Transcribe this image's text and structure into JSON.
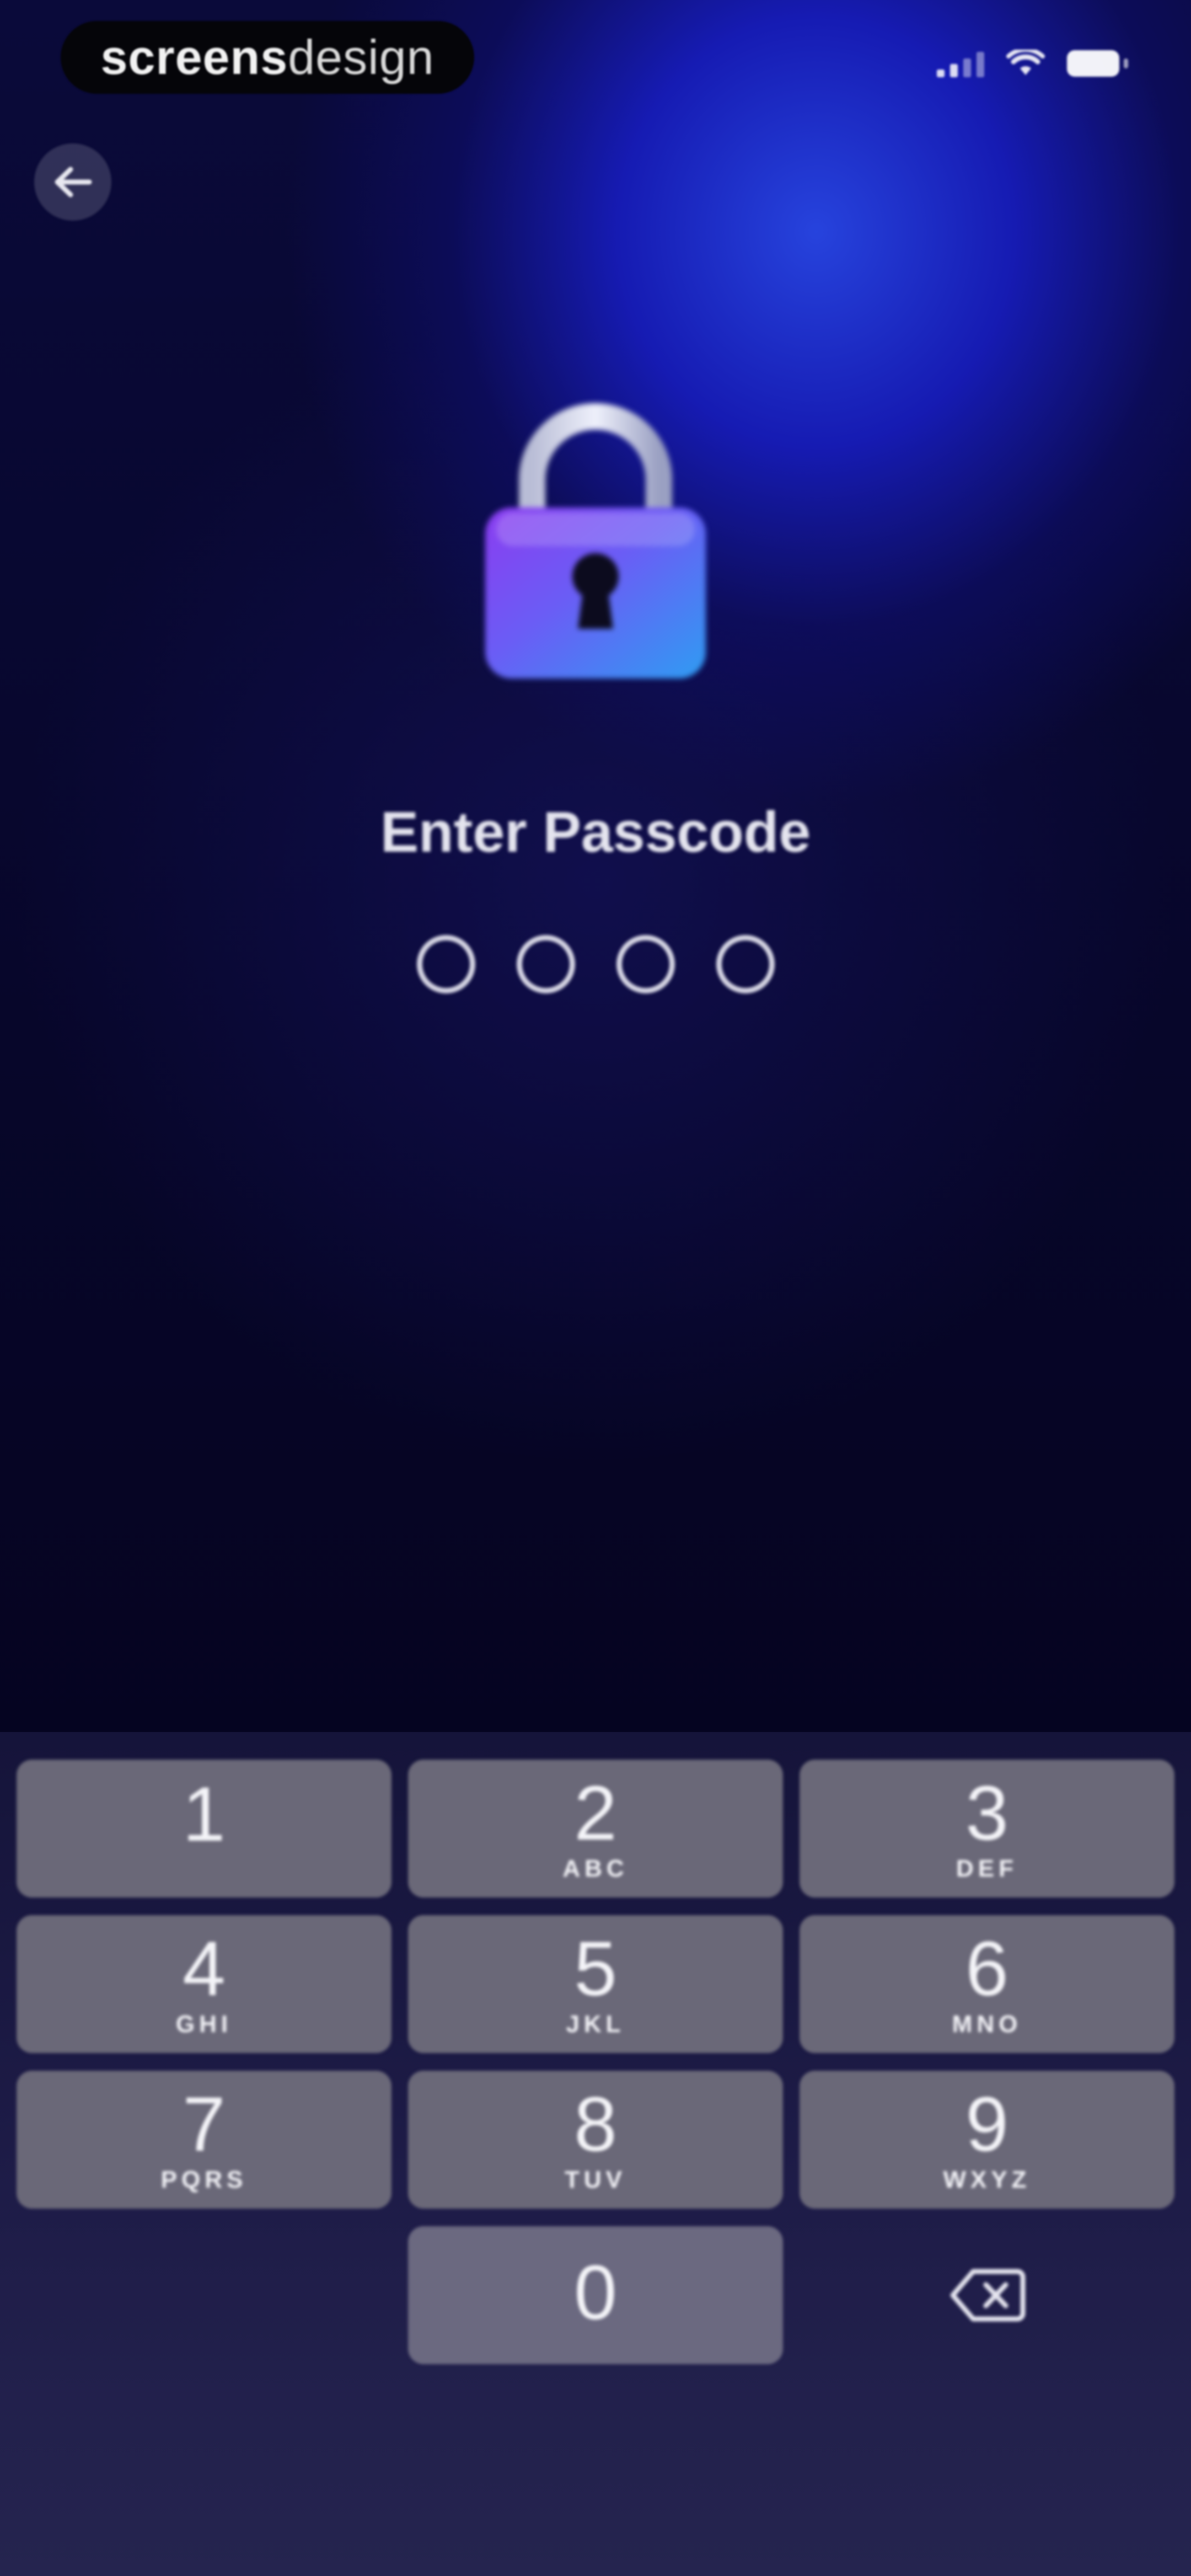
{
  "status_bar": {
    "brand_bold": "screens",
    "brand_light": "design",
    "signal_icon": "cellular-signal-icon",
    "wifi_icon": "wifi-icon",
    "battery_icon": "battery-icon"
  },
  "header": {
    "back_icon": "arrow-left-icon"
  },
  "lock_icon": "padlock-icon",
  "title": "Enter Passcode",
  "passcode": {
    "length": 4,
    "filled": 0
  },
  "keypad": {
    "keys": [
      {
        "num": "1",
        "letters": ""
      },
      {
        "num": "2",
        "letters": "ABC"
      },
      {
        "num": "3",
        "letters": "DEF"
      },
      {
        "num": "4",
        "letters": "GHI"
      },
      {
        "num": "5",
        "letters": "JKL"
      },
      {
        "num": "6",
        "letters": "MNO"
      },
      {
        "num": "7",
        "letters": "PQRS"
      },
      {
        "num": "8",
        "letters": "TUV"
      },
      {
        "num": "9",
        "letters": "WXYZ"
      },
      {
        "num": "0",
        "letters": ""
      }
    ],
    "delete_icon": "backspace-icon"
  },
  "colors": {
    "accent_blue": "#1f2fd6",
    "background_dark": "#060518",
    "key_fill": "#6a6878"
  }
}
